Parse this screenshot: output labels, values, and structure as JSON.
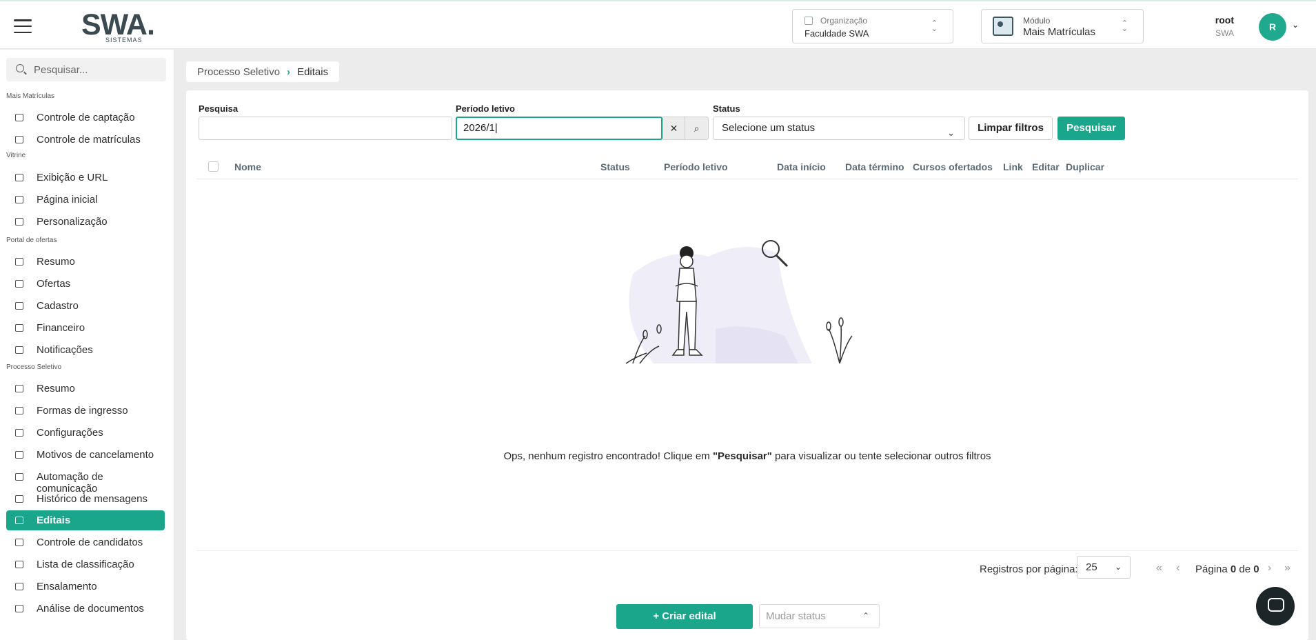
{
  "header": {
    "logo_text": "SWA",
    "logo_sub": "SISTEMAS",
    "org_label": "Organização",
    "org_value": "Faculdade SWA",
    "module_label": "Módulo",
    "module_value": "Mais Matrículas",
    "user_name": "root",
    "user_company": "SWA",
    "avatar_letter": "R"
  },
  "sidebar": {
    "search_placeholder": "Pesquisar...",
    "sections": [
      {
        "title": "Mais Matrículas",
        "items": [
          "Controle de captação",
          "Controle de matrículas"
        ]
      },
      {
        "title": "Vitrine",
        "items": [
          "Exibição e URL",
          "Página inicial",
          "Personalização"
        ]
      },
      {
        "title": "Portal de ofertas",
        "items": [
          "Resumo",
          "Ofertas",
          "Cadastro",
          "Financeiro",
          "Notificações"
        ]
      },
      {
        "title": "Processo Seletivo",
        "items": [
          "Resumo",
          "Formas de ingresso",
          "Configurações",
          "Motivos de cancelamento",
          "Automação de comunicação",
          "Histórico de mensagens",
          "Editais",
          "Controle de candidatos",
          "Lista de classificação",
          "Ensalamento",
          "Análise de documentos"
        ]
      }
    ],
    "active_item": "Editais"
  },
  "breadcrumb": {
    "parent": "Processo Seletivo",
    "current": "Editais"
  },
  "filters": {
    "search_label": "Pesquisa",
    "search_value": "",
    "period_label": "Período letivo",
    "period_value": "2026/1",
    "status_label": "Status",
    "status_placeholder": "Selecione um status",
    "clear_label": "Limpar filtros",
    "search_button": "Pesquisar"
  },
  "table": {
    "columns": [
      "Nome",
      "Status",
      "Período letivo",
      "Data início",
      "Data término",
      "Cursos ofertados",
      "Link",
      "Editar",
      "Duplicar"
    ]
  },
  "empty": {
    "before": "Ops, nenhum registro encontrado! Clique em ",
    "bold": "\"Pesquisar\"",
    "after": " para visualizar ou tente selecionar outros filtros"
  },
  "pagination": {
    "per_page_label": "Registros por página:",
    "per_page_value": "25",
    "page_word": "Página",
    "page_current": "0",
    "of_word": "de",
    "page_total": "0"
  },
  "footer": {
    "create_label": "+  Criar edital",
    "status_placeholder": "Mudar status"
  },
  "colors": {
    "accent": "#1aa68b"
  }
}
